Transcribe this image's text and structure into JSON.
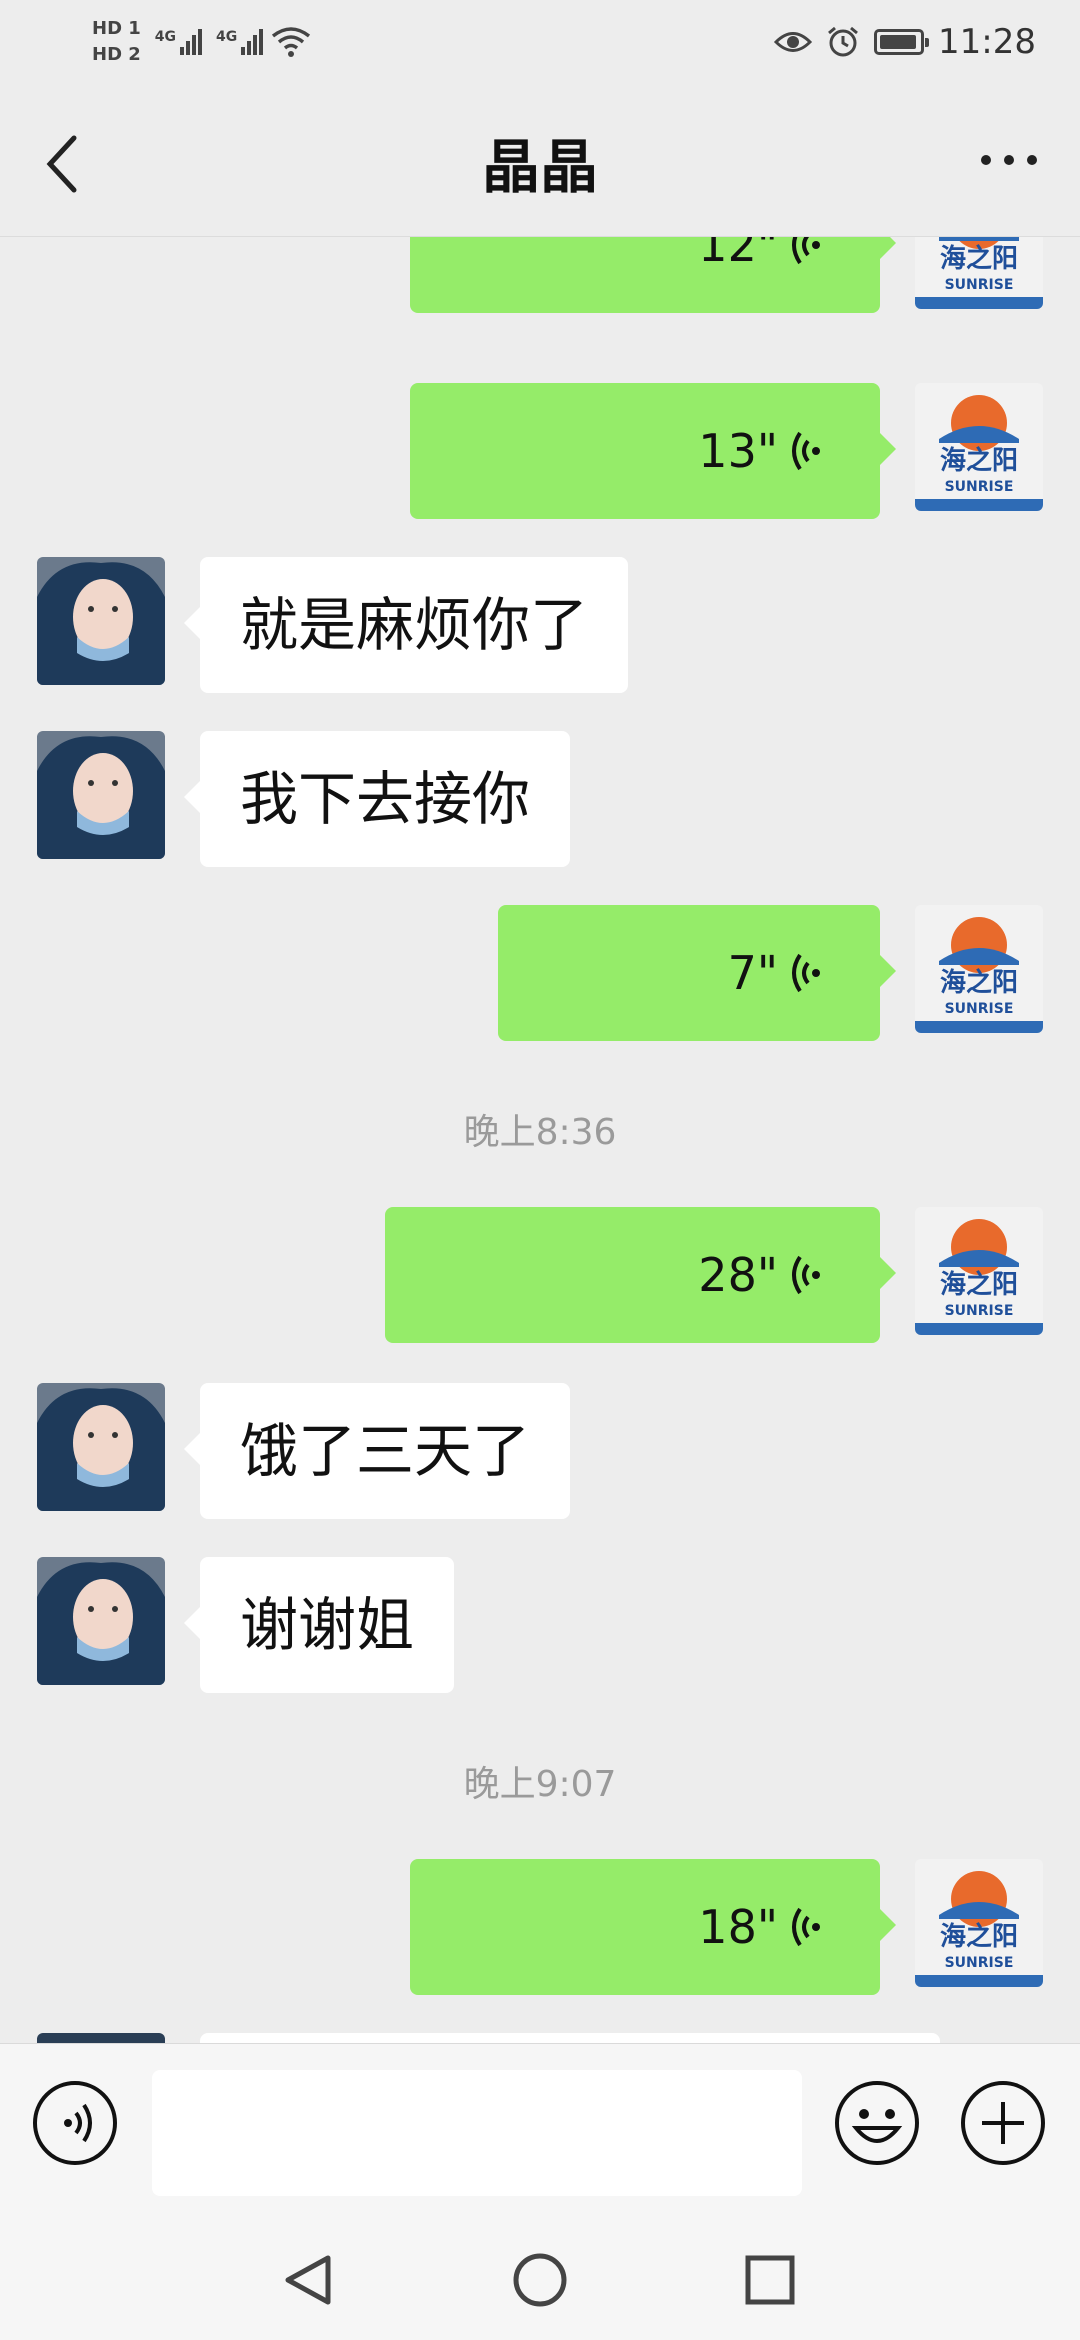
{
  "status_bar": {
    "sim1": "HD 1",
    "sim2": "HD 2",
    "net1": "4G",
    "net2": "4G",
    "time": "11:28",
    "icons": [
      "eye-icon",
      "alarm-icon",
      "battery-icon",
      "wifi-icon"
    ]
  },
  "header": {
    "title": "晶晶",
    "back_icon": "chevron-left-icon",
    "more_icon": "more-dots-icon"
  },
  "colors": {
    "outgoing_bubble": "#95ec69",
    "incoming_bubble": "#ffffff",
    "background": "#ededed"
  },
  "messages": [
    {
      "side": "out",
      "type": "voice",
      "duration": "12\""
    },
    {
      "side": "out",
      "type": "voice",
      "duration": "13\""
    },
    {
      "side": "in",
      "type": "text",
      "text": "就是麻烦你了"
    },
    {
      "side": "in",
      "type": "text",
      "text": "我下去接你"
    },
    {
      "side": "out",
      "type": "voice",
      "duration": "7\""
    },
    {
      "type": "time",
      "text": "晚上8:36"
    },
    {
      "side": "out",
      "type": "voice",
      "duration": "28\""
    },
    {
      "side": "in",
      "type": "text",
      "text": "饿了三天了"
    },
    {
      "side": "in",
      "type": "text",
      "text": "谢谢姐"
    },
    {
      "type": "time",
      "text": "晚上9:07"
    },
    {
      "side": "out",
      "type": "voice",
      "duration": "18\""
    }
  ],
  "input_bar": {
    "voice_icon": "voice-input-icon",
    "emoji_icon": "emoji-icon",
    "plus_icon": "plus-icon",
    "text_value": ""
  },
  "nav_bar": {
    "back": "nav-back-icon",
    "home": "nav-home-icon",
    "recents": "nav-recents-icon"
  }
}
